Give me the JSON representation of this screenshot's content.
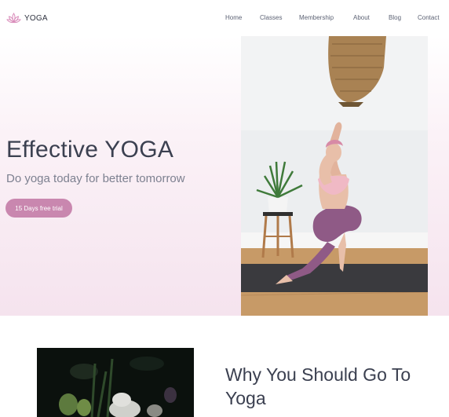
{
  "brand": {
    "name": "YOGA",
    "icon": "lotus-icon",
    "icon_color": "#d98cba"
  },
  "nav": {
    "items": [
      {
        "label": "Home"
      },
      {
        "label": "Classes"
      },
      {
        "label": "Membership"
      },
      {
        "label": "About"
      },
      {
        "label": "Blog"
      },
      {
        "label": "Contact"
      }
    ]
  },
  "hero": {
    "title": "Effective YOGA",
    "subtitle": "Do yoga today for better tomorrow",
    "cta_label": "15 Days free trial",
    "cta_color": "#c987af"
  },
  "why": {
    "title": "Why You Should Go To Yoga"
  }
}
